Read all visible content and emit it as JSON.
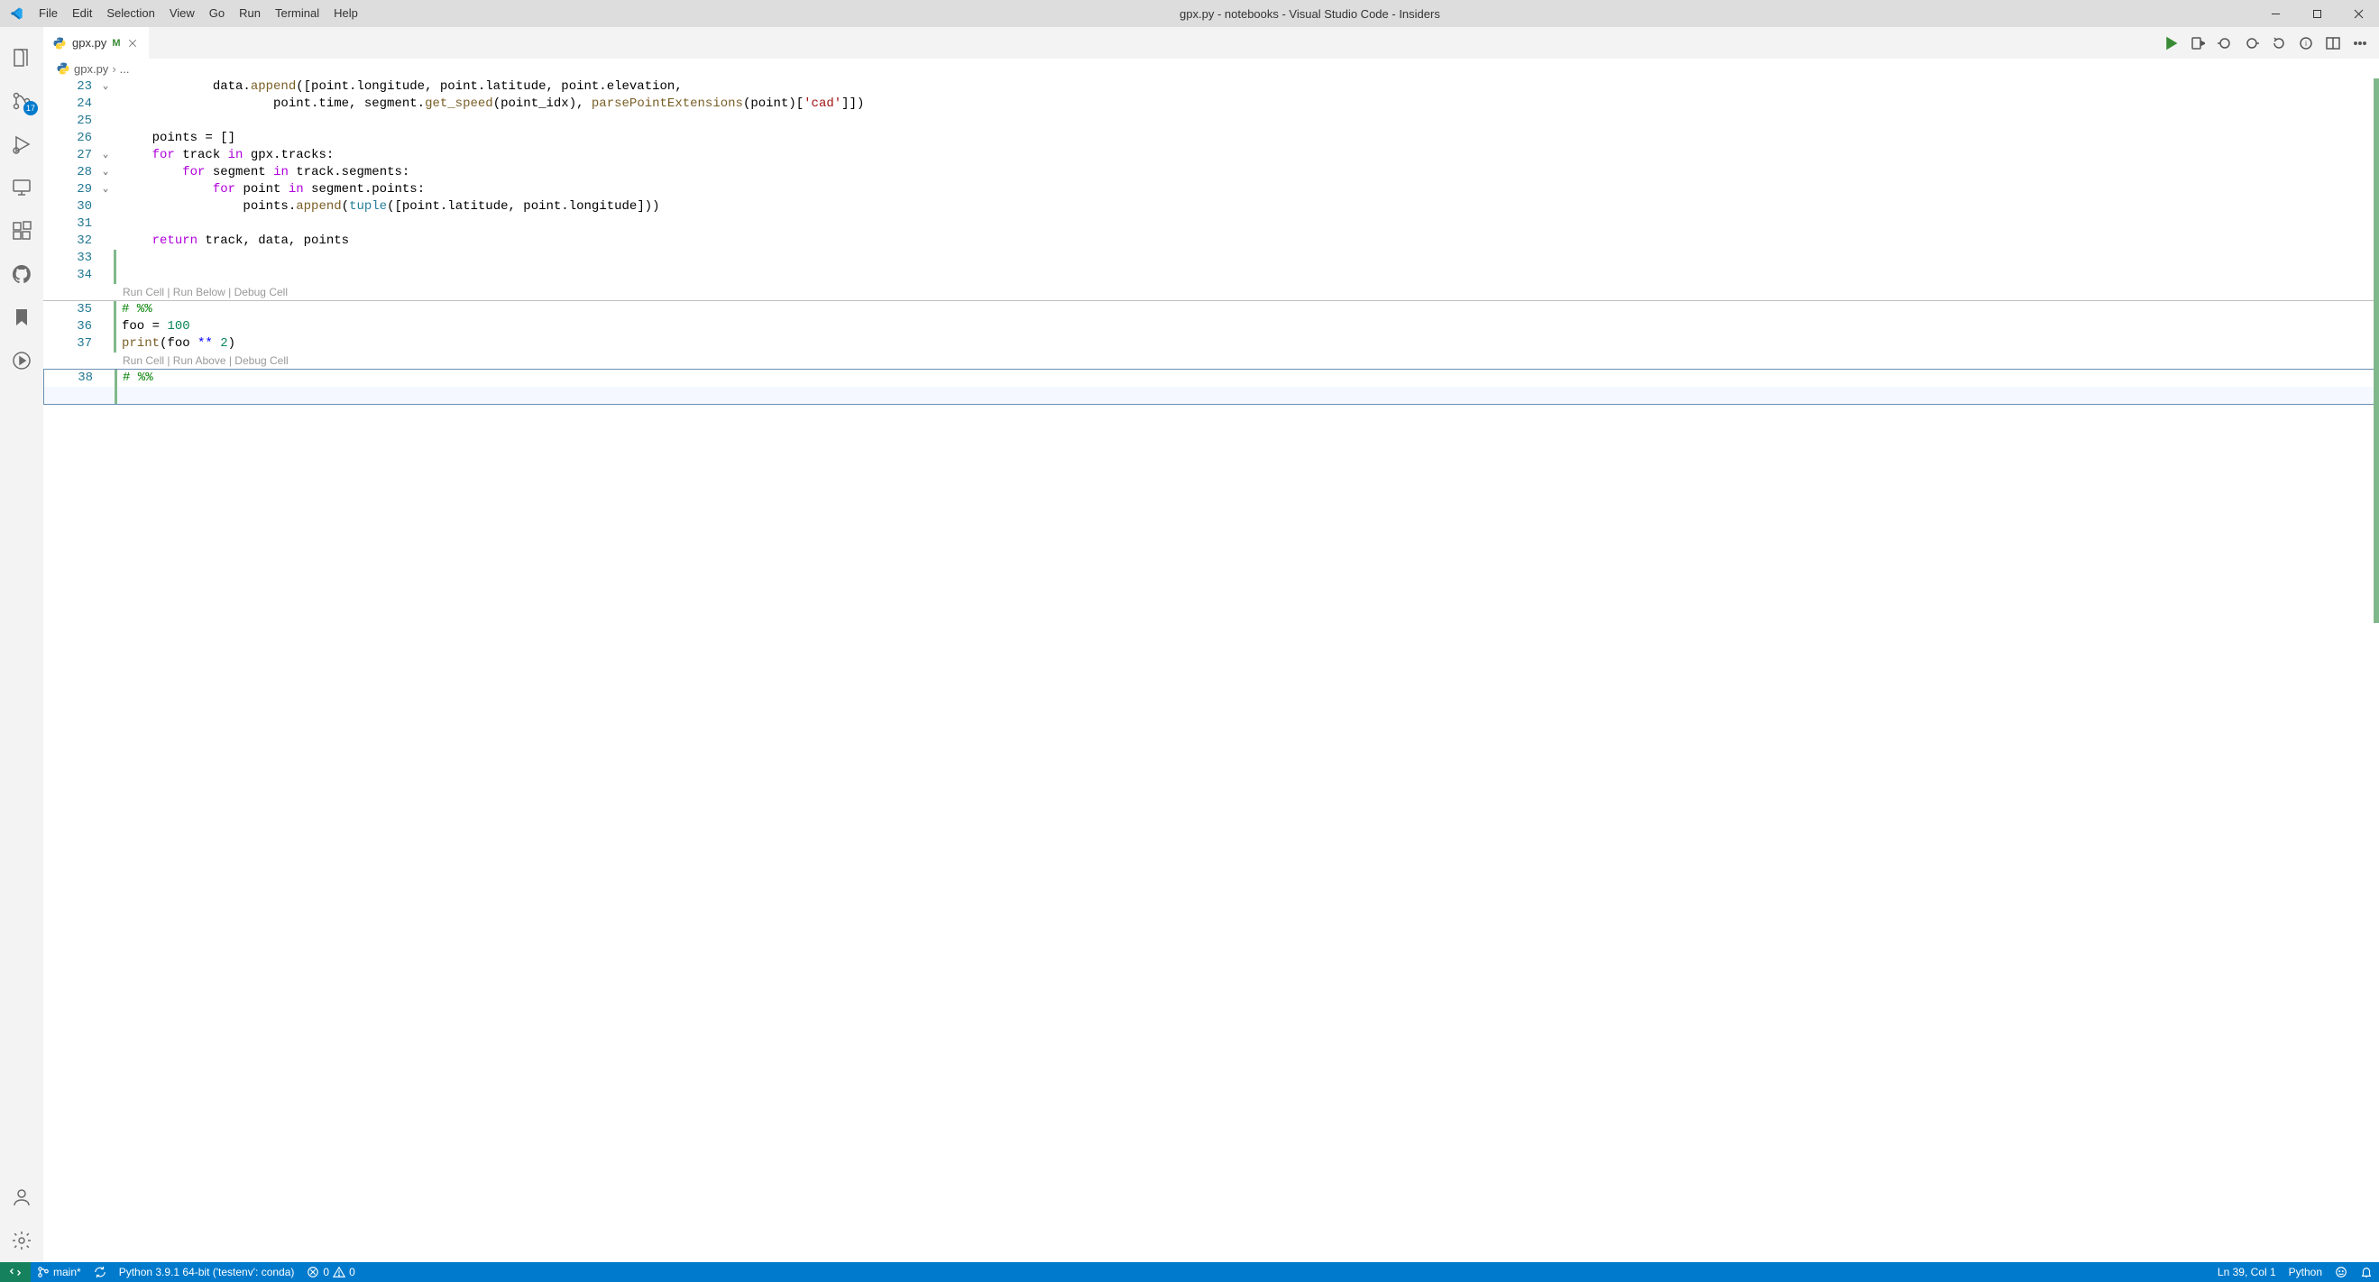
{
  "titlebar": {
    "menus": [
      "File",
      "Edit",
      "Selection",
      "View",
      "Go",
      "Run",
      "Terminal",
      "Help"
    ],
    "title": "gpx.py - notebooks - Visual Studio Code - Insiders"
  },
  "activitybar": {
    "scm_badge": "17"
  },
  "tabs": {
    "file_label": "gpx.py",
    "modified_marker": "M"
  },
  "breadcrumb": {
    "file": "gpx.py",
    "tail": "..."
  },
  "lens": {
    "cell1": "Run Cell | Run Below | Debug Cell",
    "cell2": "Run Cell | Run Above | Debug Cell"
  },
  "code": {
    "lines": [
      {
        "n": 23,
        "fold": true,
        "mod": "",
        "tokens": [
          [
            "            data.",
            "plain"
          ],
          [
            "append",
            "func"
          ],
          [
            "([point.longitude, point.latitude, point.elevation,",
            "plain"
          ]
        ]
      },
      {
        "n": 24,
        "mod": "",
        "tokens": [
          [
            "                    point.time, segment.",
            "plain"
          ],
          [
            "get_speed",
            "func"
          ],
          [
            "(point_idx), ",
            "plain"
          ],
          [
            "parsePointExtensions",
            "func"
          ],
          [
            "(point)[",
            "plain"
          ],
          [
            "'cad'",
            "str"
          ],
          [
            "]])",
            "plain"
          ]
        ]
      },
      {
        "n": 25,
        "mod": "",
        "tokens": [
          [
            "",
            ""
          ]
        ]
      },
      {
        "n": 26,
        "mod": "",
        "tokens": [
          [
            "    points ",
            "plain"
          ],
          [
            "=",
            "op"
          ],
          [
            " []",
            "plain"
          ]
        ]
      },
      {
        "n": 27,
        "fold": true,
        "mod": "",
        "tokens": [
          [
            "    ",
            ""
          ],
          [
            "for",
            "ctrl"
          ],
          [
            " track ",
            "plain"
          ],
          [
            "in",
            "ctrl"
          ],
          [
            " gpx.tracks:",
            "plain"
          ]
        ]
      },
      {
        "n": 28,
        "fold": true,
        "mod": "",
        "tokens": [
          [
            "        ",
            ""
          ],
          [
            "for",
            "ctrl"
          ],
          [
            " segment ",
            "plain"
          ],
          [
            "in",
            "ctrl"
          ],
          [
            " track.segments:",
            "plain"
          ]
        ]
      },
      {
        "n": 29,
        "fold": true,
        "mod": "",
        "tokens": [
          [
            "            ",
            ""
          ],
          [
            "for",
            "ctrl"
          ],
          [
            " point ",
            "plain"
          ],
          [
            "in",
            "ctrl"
          ],
          [
            " segment.points:",
            "plain"
          ]
        ]
      },
      {
        "n": 30,
        "mod": "",
        "tokens": [
          [
            "                points.",
            "plain"
          ],
          [
            "append",
            "func"
          ],
          [
            "(",
            "plain"
          ],
          [
            "tuple",
            "builtin"
          ],
          [
            "([point.latitude, point.longitude]))",
            "plain"
          ]
        ]
      },
      {
        "n": 31,
        "mod": "",
        "tokens": [
          [
            "",
            ""
          ]
        ]
      },
      {
        "n": 32,
        "mod": "",
        "tokens": [
          [
            "    ",
            ""
          ],
          [
            "return",
            "ctrl"
          ],
          [
            " track, data, points",
            "plain"
          ]
        ]
      },
      {
        "n": 33,
        "mod": "add",
        "tokens": [
          [
            "",
            ""
          ]
        ]
      },
      {
        "n": 34,
        "mod": "add",
        "tokens": [
          [
            "",
            ""
          ]
        ]
      }
    ],
    "cell1": [
      {
        "n": 35,
        "mod": "add",
        "tokens": [
          [
            "# %%",
            "comm"
          ]
        ]
      },
      {
        "n": 36,
        "mod": "add",
        "tokens": [
          [
            "foo ",
            "plain"
          ],
          [
            "=",
            "op"
          ],
          [
            " ",
            "plain"
          ],
          [
            "100",
            "num"
          ]
        ]
      },
      {
        "n": 37,
        "mod": "add",
        "tokens": [
          [
            "print",
            "func"
          ],
          [
            "(foo ",
            "plain"
          ],
          [
            "**",
            "kw"
          ],
          [
            " ",
            "plain"
          ],
          [
            "2",
            "num"
          ],
          [
            ")",
            "plain"
          ]
        ]
      }
    ],
    "cell2": [
      {
        "n": 38,
        "mod": "add",
        "tokens": [
          [
            "# %%",
            "comm"
          ]
        ]
      }
    ]
  },
  "statusbar": {
    "branch": "main*",
    "python": "Python 3.9.1 64-bit ('testenv': conda)",
    "errors": "0",
    "warnings": "0",
    "lncol": "Ln 39, Col 1",
    "lang": "Python"
  }
}
